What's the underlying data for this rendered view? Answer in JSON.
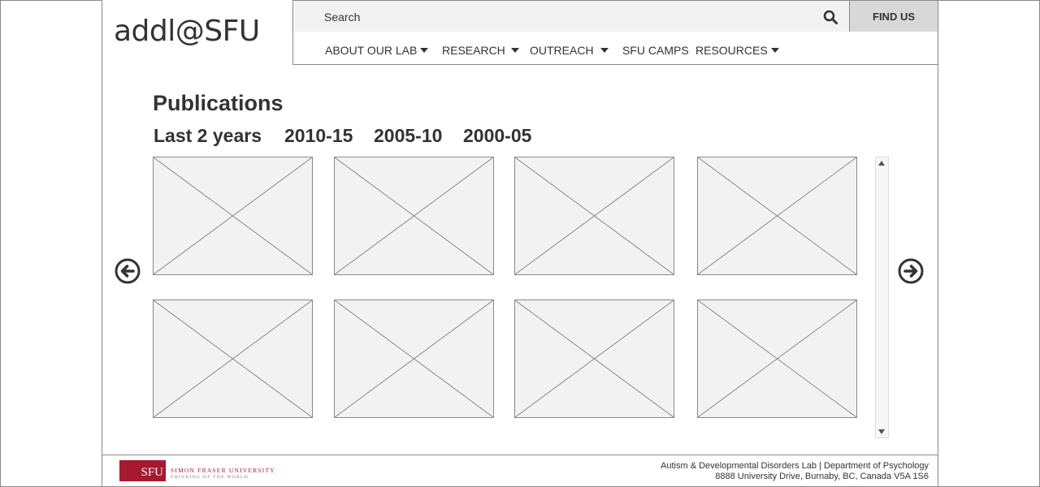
{
  "header": {
    "logo": "addl@SFU",
    "search": {
      "placeholder": "Search"
    },
    "find_us": "FIND US"
  },
  "nav": {
    "items": [
      {
        "label": "ABOUT OUR LAB",
        "has_dropdown": true
      },
      {
        "label": "RESEARCH",
        "has_dropdown": true
      },
      {
        "label": "OUTREACH",
        "has_dropdown": true
      },
      {
        "label": "SFU CAMPS",
        "has_dropdown": false
      },
      {
        "label": "RESOURCES",
        "has_dropdown": true
      }
    ]
  },
  "main": {
    "title": "Publications",
    "tabs": [
      "Last 2 years",
      "2010-15",
      "2005-10",
      "2000-05"
    ],
    "thumbnail_count": 8,
    "prev_icon": "arrow-left-circle-icon",
    "next_icon": "arrow-right-circle-icon"
  },
  "footer": {
    "sfu_mark": "SFU",
    "university_name": "SIMON FRASER UNIVERSITY",
    "tagline": "THINKING OF THE WORLD",
    "line1": "Autism & Developmental Disorders Lab | Department of Psychology",
    "line2": "8888 University Drive, Burnaby, BC, Canada V5A 1S6"
  },
  "colors": {
    "placeholder_fill": "#f2f2f2",
    "border": "#8a8a8a",
    "sfu_red": "#a6192e",
    "text": "#333333"
  }
}
